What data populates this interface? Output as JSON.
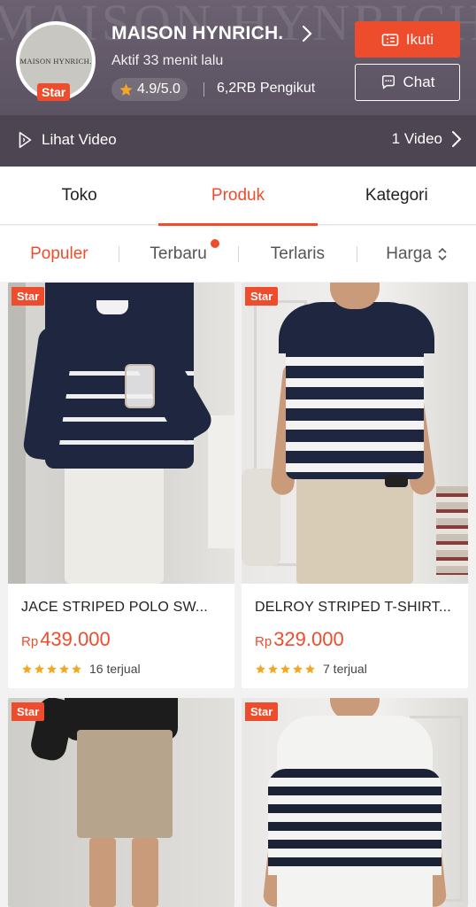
{
  "header": {
    "watermark": "MAISON HYNRICH.",
    "logo_text": "MAISON HYNRICH.",
    "star_badge": "Star",
    "shop_name": "MAISON HYNRICH.",
    "active_status": "Aktif 33 menit lalu",
    "rating": "4.9/5.0",
    "followers": "6,2RB Pengikut",
    "follow_label": "Ikuti",
    "chat_label": "Chat"
  },
  "video_bar": {
    "label": "Lihat Video",
    "count": "1 Video"
  },
  "tabs": [
    {
      "label": "Toko"
    },
    {
      "label": "Produk"
    },
    {
      "label": "Kategori"
    }
  ],
  "sort": [
    {
      "label": "Populer"
    },
    {
      "label": "Terbaru"
    },
    {
      "label": "Terlaris"
    },
    {
      "label": "Harga"
    }
  ],
  "products": [
    {
      "tag": "Star",
      "title": "JACE  STRIPED POLO SW...",
      "currency": "Rp",
      "price": "439.000",
      "sold": "16 terjual",
      "rating_stars": 5
    },
    {
      "tag": "Star",
      "title": "DELROY STRIPED T-SHIRT...",
      "currency": "Rp",
      "price": "329.000",
      "sold": "7 terjual",
      "rating_stars": 5
    },
    {
      "tag": "Star"
    },
    {
      "tag": "Star"
    }
  ],
  "colors": {
    "accent": "#ee4d2d",
    "header_bg": "#5b5262",
    "video_bar_bg": "#4d4552",
    "star": "#f5a623"
  }
}
